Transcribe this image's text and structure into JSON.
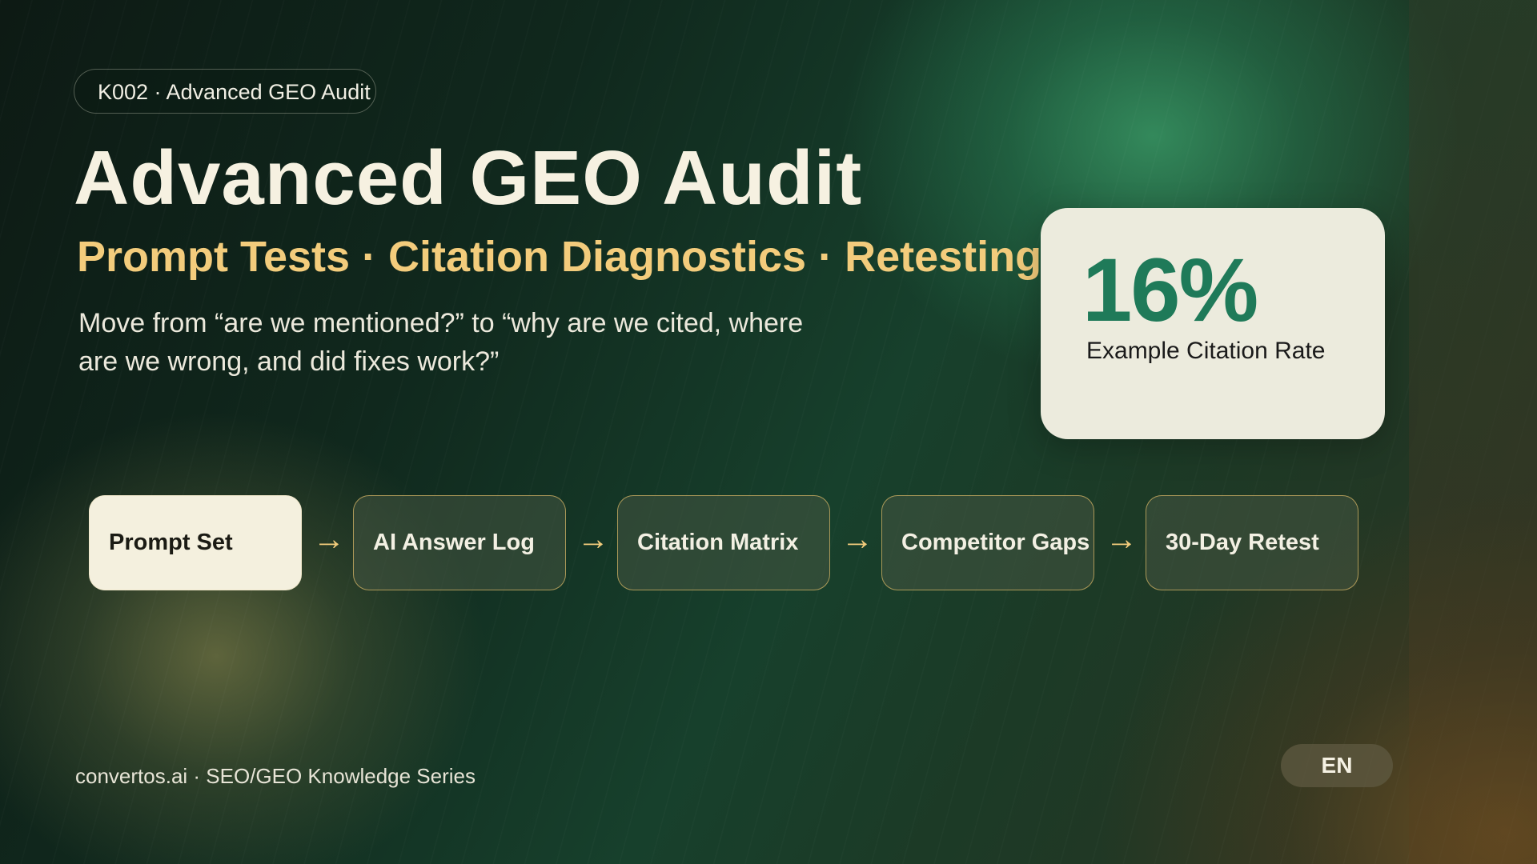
{
  "badge": {
    "label": "K002 · Advanced GEO Audit"
  },
  "title": "Advanced GEO Audit",
  "subtitle": "Prompt Tests · Citation Diagnostics · Retesting Matrix",
  "description": "Move from “are we mentioned?” to “why are we cited, where are we wrong, and did fixes work?”",
  "stat": {
    "value": "16%",
    "label": "Example Citation Rate"
  },
  "flow": {
    "steps": [
      "Prompt Set",
      "AI Answer Log",
      "Citation Matrix",
      "Competitor Gaps",
      "30-Day Retest"
    ],
    "arrow": "→",
    "active_index": 0
  },
  "footer": "convertos.ai · SEO/GEO Knowledge Series",
  "language": "EN",
  "colors": {
    "accent_gold": "#f3cc7c",
    "stat_green": "#1f7a59",
    "card_bg": "#ecebdd"
  }
}
